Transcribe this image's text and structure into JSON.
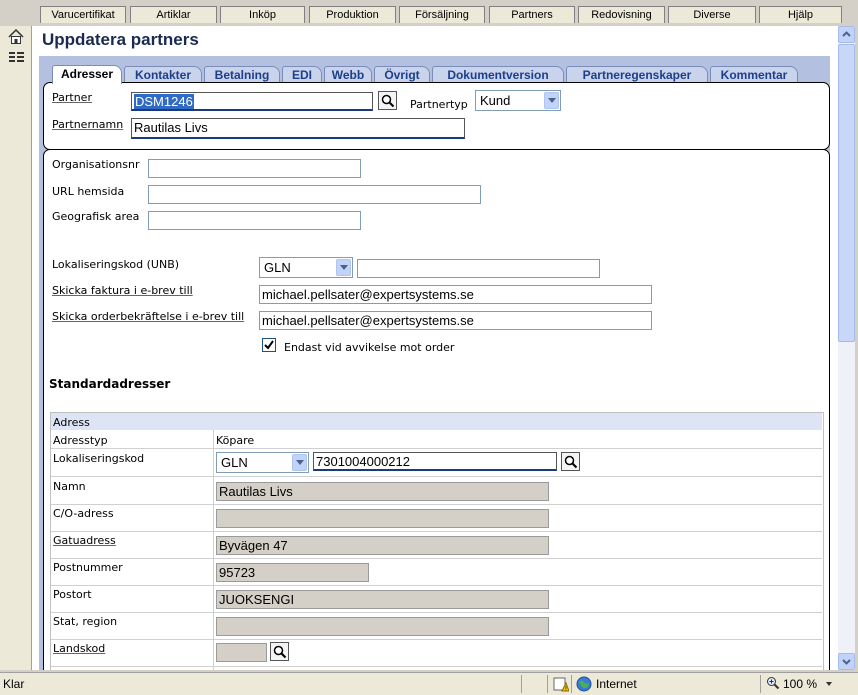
{
  "menu": [
    "Varucertifikat",
    "Artiklar",
    "Inköp",
    "Produktion",
    "Försäljning",
    "Partners",
    "Redovisning",
    "Diverse",
    "Hjälp"
  ],
  "page_title": "Uppdatera partners",
  "tabs": [
    "Adresser",
    "Kontakter",
    "Betalning",
    "EDI",
    "Webb",
    "Övrigt",
    "Dokumentversion",
    "Partneregenskaper",
    "Kommentar"
  ],
  "partner": {
    "partner_label": "Partner",
    "partner_value": "DSM1246",
    "partnertyp_label": "Partnertyp",
    "partnertyp_value": "Kund",
    "partnernamn_label": "Partnernamn",
    "partnernamn_value": "Rautilas Livs"
  },
  "general": {
    "org_label": "Organisationsnr",
    "org_value": "",
    "url_label": "URL hemsida",
    "url_value": "",
    "geo_label": "Geografisk area",
    "geo_value": "",
    "lok_label": "Lokaliseringskod (UNB)",
    "lok_type": "GLN",
    "lok_value": "",
    "faktura_label": "Skicka faktura i e-brev till",
    "faktura_value": "michael.pellsater@expertsystems.se",
    "order_label": "Skicka orderbekräftelse i e-brev till",
    "order_value": "michael.pellsater@expertsystems.se",
    "avvikelse_label": "Endast vid avvikelse mot order",
    "avvikelse_checked": true
  },
  "standard": {
    "heading": "Standardadresser",
    "section": "Adress",
    "adresstyp_label": "Adresstyp",
    "adresstyp_value": "Köpare",
    "lok_label": "Lokaliseringskod",
    "lok_type": "GLN",
    "lok_value": "7301004000212",
    "namn_label": "Namn",
    "namn_value": "Rautilas Livs",
    "co_label": "C/O-adress",
    "co_value": "",
    "gatu_label": "Gatuadress",
    "gatu_value": "Byvägen 47",
    "postnr_label": "Postnummer",
    "postnr_value": "95723",
    "postort_label": "Postort",
    "postort_value": "JUOKSENGI",
    "stat_label": "Stat, region",
    "stat_value": "",
    "land_label": "Landskod",
    "land_value": ""
  },
  "status": {
    "left": "Klar",
    "zone": "Internet",
    "zoom": "100 %"
  }
}
